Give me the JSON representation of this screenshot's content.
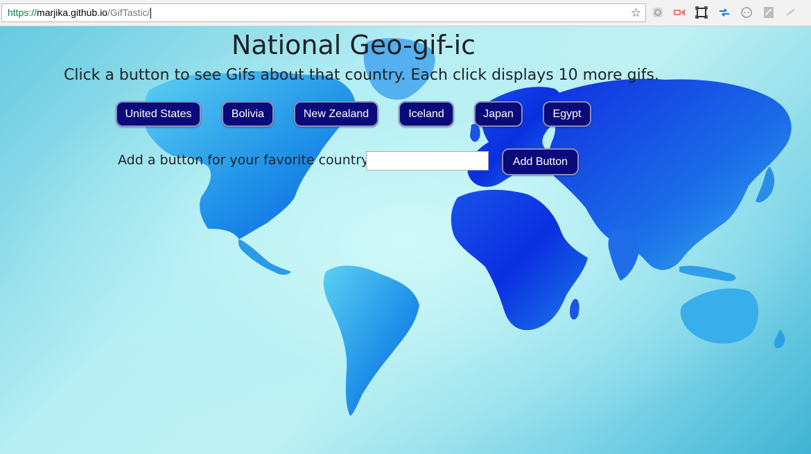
{
  "browser": {
    "url_scheme": "https://",
    "url_host": "marjika.github.io",
    "url_path": "/GifTastic/"
  },
  "page": {
    "title": "National Geo-gif-ic",
    "subtitle": "Click a button to see Gifs about that country. Each click displays 10 more gifs.",
    "countries": [
      "United States",
      "Bolivia",
      "New Zealand",
      "Iceland",
      "Japan",
      "Egypt"
    ],
    "add_label": "Add a button for your favorite country.",
    "add_input_value": "",
    "add_button_label": "Add Button"
  },
  "colors": {
    "button_bg": "#0a0a7a",
    "button_border": "#8d8dbd",
    "map_dark": "#0a2fe0",
    "map_light": "#37b6ec"
  },
  "icons": [
    "bookmark-star-icon",
    "extension-settings-icon",
    "extension-video-icon",
    "screenshot-icon",
    "sync-arrows-icon",
    "extension-circle-icon",
    "pdf-icon",
    "extension-feather-icon"
  ]
}
